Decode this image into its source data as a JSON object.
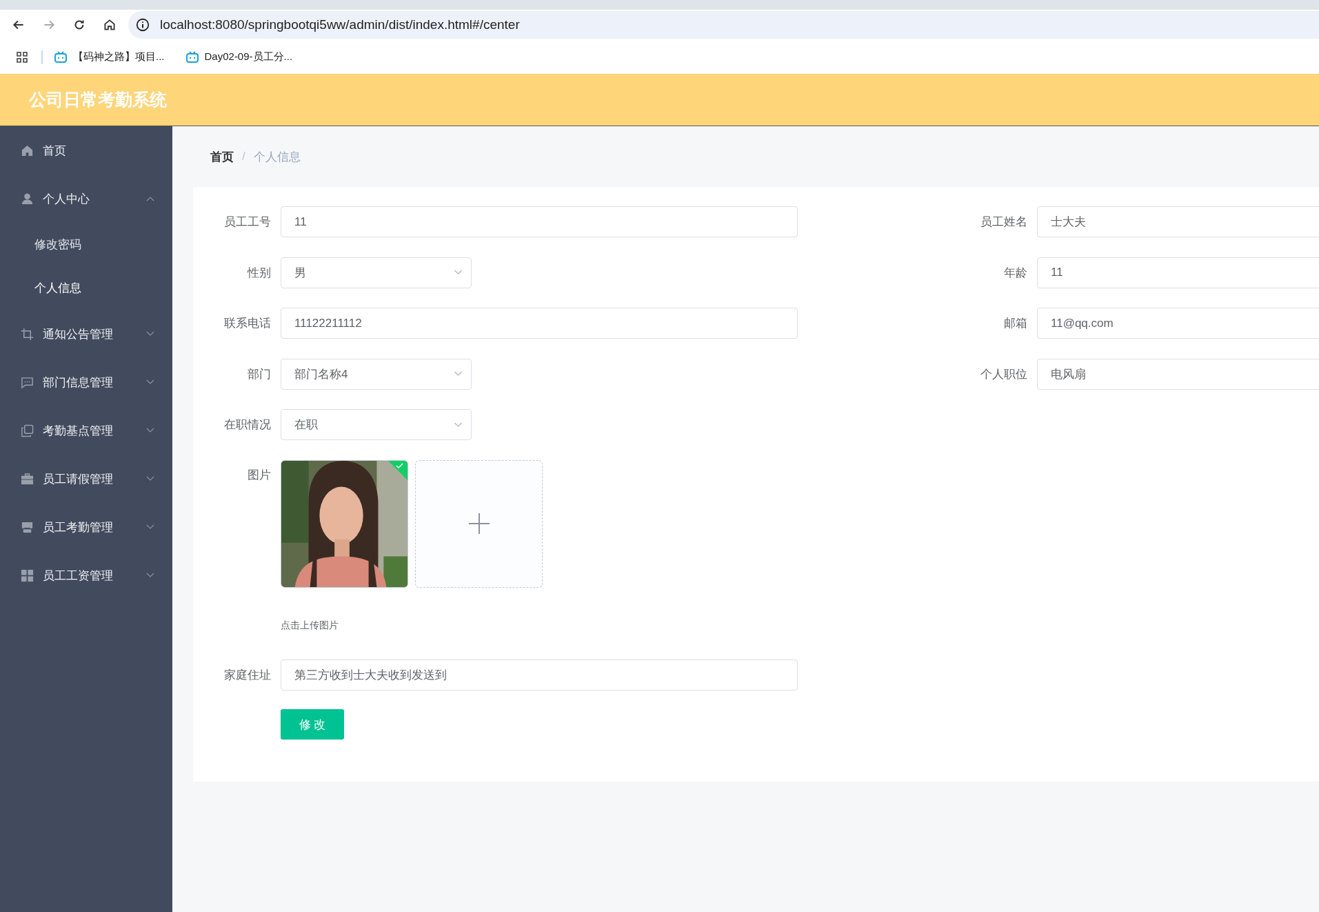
{
  "browser": {
    "url": "localhost:8080/springbootqi5ww/admin/dist/index.html#/center",
    "forward_disabled": true,
    "bookmarks": [
      "【码神之路】项目...",
      "Day02-09-员工分..."
    ]
  },
  "header": {
    "title": "公司日常考勤系统"
  },
  "sidebar": {
    "items": [
      {
        "label": "首页"
      },
      {
        "label": "个人中心",
        "expanded": true,
        "children": [
          {
            "label": "修改密码",
            "selected": false
          },
          {
            "label": "个人信息",
            "selected": true
          }
        ]
      },
      {
        "label": "通知公告管理",
        "expanded": false
      },
      {
        "label": "部门信息管理",
        "expanded": false
      },
      {
        "label": "考勤基点管理",
        "expanded": false
      },
      {
        "label": "员工请假管理",
        "expanded": false
      },
      {
        "label": "员工考勤管理",
        "expanded": false
      },
      {
        "label": "员工工资管理",
        "expanded": false
      }
    ]
  },
  "breadcrumb": {
    "items": [
      "首页",
      "个人信息"
    ],
    "separator": "/"
  },
  "form": {
    "left": [
      {
        "label": "员工工号",
        "value": "11",
        "kind": "input"
      },
      {
        "label": "性别",
        "value": "男",
        "kind": "select"
      },
      {
        "label": "联系电话",
        "value": "11122211112",
        "kind": "input"
      },
      {
        "label": "部门",
        "value": "部门名称4",
        "kind": "select"
      },
      {
        "label": "在职情况",
        "value": "在职",
        "kind": "select"
      }
    ],
    "right": [
      {
        "label": "员工姓名",
        "value": "士大夫",
        "kind": "input"
      },
      {
        "label": "年龄",
        "value": "11",
        "kind": "input"
      },
      {
        "label": "邮箱",
        "value": "11@qq.com",
        "kind": "input"
      },
      {
        "label": "个人职位",
        "value": "电风扇",
        "kind": "input"
      }
    ],
    "image": {
      "label": "图片",
      "images": [
        {
          "kind": "picture",
          "uploaded": true
        }
      ],
      "hint": "点击上传图片"
    },
    "address": {
      "label": "家庭住址",
      "value": "第三方收到士大夫收到发送到"
    },
    "submit": "修 改"
  }
}
